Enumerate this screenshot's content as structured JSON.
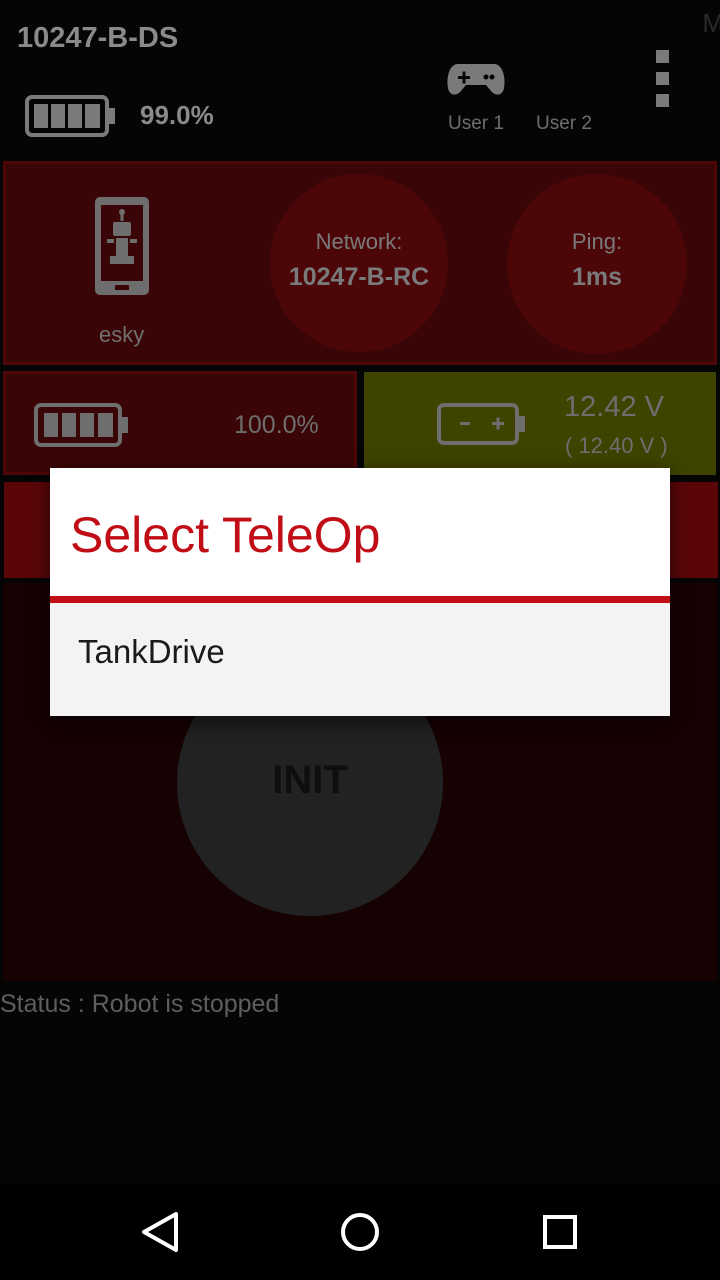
{
  "header": {
    "team_name": "10247-B-DS",
    "corner_letter": "M",
    "ds_battery": "99.0%",
    "users": [
      "User 1",
      "User 2"
    ]
  },
  "robot": {
    "name": "esky",
    "network_label": "Network:",
    "network_value": "10247-B-RC",
    "ping_label": "Ping:",
    "ping_value": "1ms",
    "rc_battery": "100.0%",
    "voltage": "12.42 V",
    "voltage_min": "( 12.40 V )"
  },
  "controls": {
    "init_label": "INIT",
    "status": "Status : Robot is stopped"
  },
  "dialog": {
    "title": "Select TeleOp",
    "items": [
      "TankDrive"
    ]
  },
  "colors": {
    "accent_red": "#c10d16",
    "voltage_ok": "#3e4300"
  }
}
